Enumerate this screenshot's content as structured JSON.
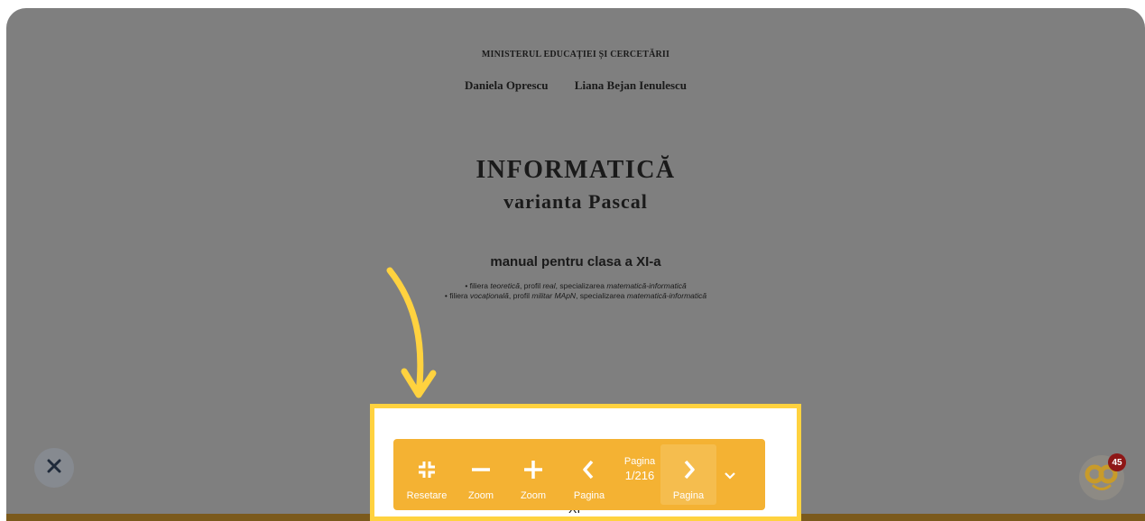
{
  "document": {
    "ministry": "MINISTERUL EDUCAȚIEI ȘI CERCETĂRII",
    "author1": "Daniela Oprescu",
    "author2": "Liana Bejan Ienulescu",
    "title": "INFORMATICĂ",
    "subtitle": "varianta Pascal",
    "manual": "manual pentru clasa a XI-a",
    "filiera1": {
      "a": "• filiera ",
      "b": "teoretică",
      "c": ", profil ",
      "d": "real",
      "e": ", specializarea ",
      "f": "matematică-informatică"
    },
    "filiera2": {
      "a": "• filiera ",
      "b": "vocațională",
      "c": ", profil ",
      "d": "militar MApN",
      "e": ", specializarea ",
      "f": "matematică-informatică"
    },
    "footer_text": "XI"
  },
  "toolbar": {
    "reset_label": "Resetare",
    "zoom_out_label": "Zoom",
    "zoom_in_label": "Zoom",
    "prev_label": "Pagina",
    "page_label": "Pagina",
    "page_number": "1/216",
    "next_label": "Pagina"
  },
  "mascot": {
    "badge_count": "45"
  },
  "colors": {
    "toolbar": "#f4b233",
    "highlight": "#ffd23f",
    "overlay": "#7f7f7f",
    "badge": "#8e1717"
  },
  "icons": [
    "collapse-icon",
    "minus-icon",
    "plus-icon",
    "chevron-left-icon",
    "chevron-right-icon",
    "chevron-down-icon",
    "close-icon",
    "mascot-icon",
    "annotation-arrow"
  ]
}
